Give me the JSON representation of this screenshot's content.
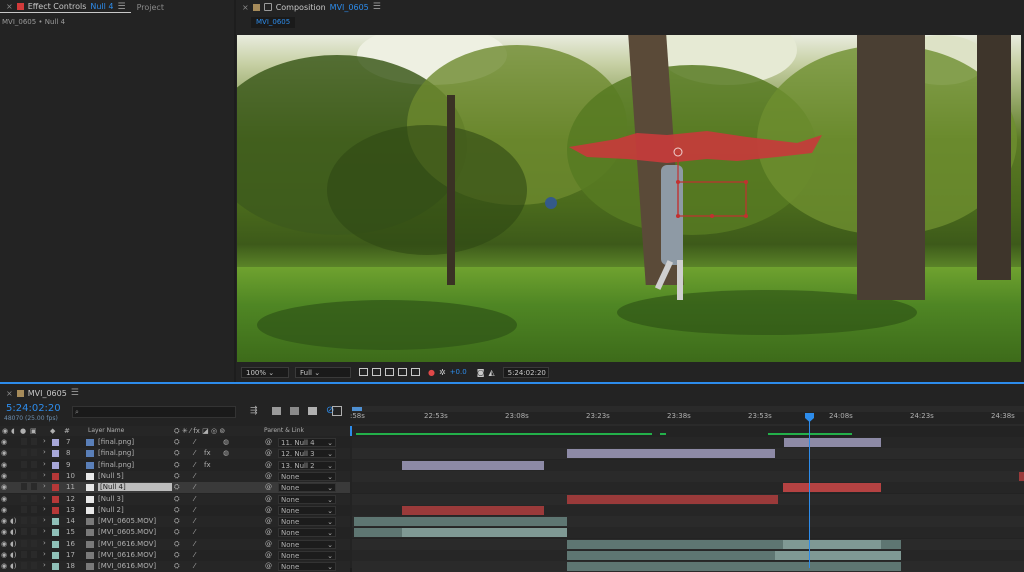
{
  "effect_controls": {
    "tab_label": "Effect Controls",
    "layer": "Null 4",
    "project_tab": "Project",
    "breadcrumb": "MVI_0605 • Null 4"
  },
  "composition": {
    "tab_label": "Composition",
    "name": "MVI_0605",
    "sub_tab": "MVI_0605"
  },
  "viewer_toolbar": {
    "zoom": "100%",
    "resolution": "Full",
    "exposure": "+0.0",
    "timecode": "5:24:02:20"
  },
  "timeline": {
    "comp_tab": "MVI_0605",
    "current_time": "5:24:02:20",
    "frame_info": "48070 (25.00 fps)",
    "search_placeholder": "",
    "col_layer_name": "Layer Name",
    "col_parent": "Parent & Link",
    "ruler": [
      ":58s",
      "22:53s",
      "23:08s",
      "23:23s",
      "23:38s",
      "23:53s",
      "24:08s",
      "24:23s",
      "24:38s"
    ],
    "layers": [
      {
        "num": "7",
        "name": "[final.png]",
        "parent": "11. Null 4",
        "color": "#a7a7d8",
        "kind": "img",
        "fx": false
      },
      {
        "num": "8",
        "name": "[final.png]",
        "parent": "12. Null 3",
        "color": "#a7a7d8",
        "kind": "img",
        "fx": true
      },
      {
        "num": "9",
        "name": "[final.png]",
        "parent": "13. Null 2",
        "color": "#a7a7d8",
        "kind": "img",
        "fx": true
      },
      {
        "num": "10",
        "name": "[Null 5]",
        "parent": "None",
        "color": "#b53838",
        "kind": "null",
        "fx": false
      },
      {
        "num": "11",
        "name": "[Null 4]",
        "parent": "None",
        "color": "#b53838",
        "kind": "null",
        "fx": false
      },
      {
        "num": "12",
        "name": "[Null 3]",
        "parent": "None",
        "color": "#b53838",
        "kind": "null",
        "fx": false
      },
      {
        "num": "13",
        "name": "[Null 2]",
        "parent": "None",
        "color": "#b53838",
        "kind": "null",
        "fx": false
      },
      {
        "num": "14",
        "name": "[MVI_0605.MOV]",
        "parent": "None",
        "color": "#8fc0b8",
        "kind": "mov",
        "fx": false
      },
      {
        "num": "15",
        "name": "[MVI_0605.MOV]",
        "parent": "None",
        "color": "#8fc0b8",
        "kind": "mov",
        "fx": false
      },
      {
        "num": "16",
        "name": "[MVI_0616.MOV]",
        "parent": "None",
        "color": "#8fc0b8",
        "kind": "mov",
        "fx": false
      },
      {
        "num": "17",
        "name": "[MVI_0616.MOV]",
        "parent": "None",
        "color": "#8fc0b8",
        "kind": "mov",
        "fx": false
      },
      {
        "num": "18",
        "name": "[MVI_0616.MOV]",
        "parent": "None",
        "color": "#8fc0b8",
        "kind": "mov",
        "fx": false
      }
    ]
  }
}
